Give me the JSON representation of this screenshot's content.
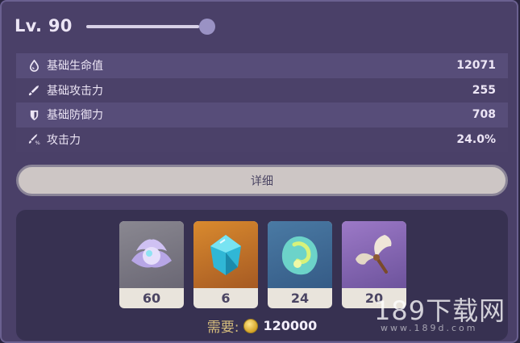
{
  "level": {
    "label": "Lv. 90",
    "slider_fraction": 0.93
  },
  "stats": [
    {
      "icon": "hp-drop-icon",
      "name": "基础生命值",
      "value": "12071"
    },
    {
      "icon": "sword-icon",
      "name": "基础攻击力",
      "value": "255"
    },
    {
      "icon": "shield-icon",
      "name": "基础防御力",
      "value": "708"
    },
    {
      "icon": "atk-bonus-icon",
      "name": "攻击力",
      "value": "24.0%"
    }
  ],
  "detail_button": {
    "label": "详细"
  },
  "materials": [
    {
      "icon": "crystal-flower-icon",
      "count": "60",
      "rarity": "gray"
    },
    {
      "icon": "cyan-gem-icon",
      "count": "6",
      "rarity": "orange"
    },
    {
      "icon": "wind-stone-icon",
      "count": "24",
      "rarity": "blue"
    },
    {
      "icon": "feather-fan-icon",
      "count": "20",
      "rarity": "purple"
    }
  ],
  "cost": {
    "label": "需要:",
    "icon": "mora-coin-icon",
    "value": "120000"
  },
  "watermark": {
    "main": "189下载网",
    "sub": "www.189d.com"
  }
}
